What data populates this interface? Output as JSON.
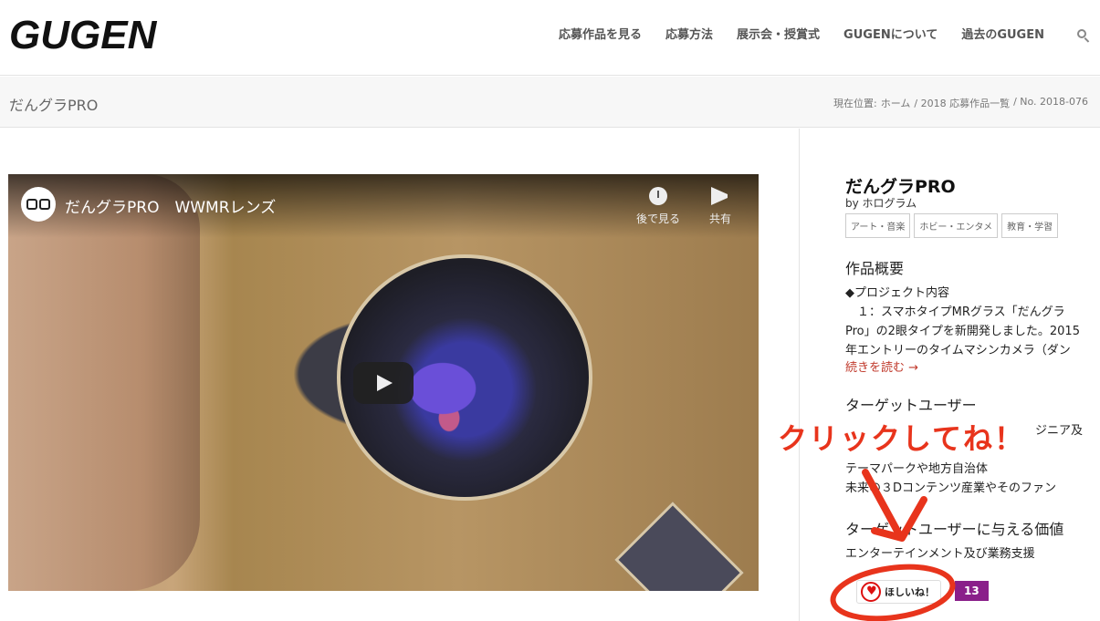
{
  "header": {
    "logo": "GUGEN",
    "nav": [
      "応募作品を見る",
      "応募方法",
      "展示会・授賞式",
      "GUGENについて",
      "過去のGUGEN"
    ]
  },
  "titlebar": {
    "title": "だんグラPRO",
    "breadcrumb_label": "現在位置:",
    "crumbs": [
      "ホーム",
      "/ 2018 応募作品一覧",
      "/ No. 2018-076"
    ]
  },
  "video": {
    "title": "だんグラPRO　WWMRレンズ",
    "watch_later": "後で見る",
    "share": "共有"
  },
  "sidebar": {
    "title": "だんグラPRO",
    "by": "by ホログラム",
    "tags": [
      "アート・音楽",
      "ホビー・エンタメ",
      "教育・学習"
    ],
    "summary_heading": "作品概要",
    "summary_lines": [
      "◆プロジェクト内容",
      "　１：スマホタイプMRグラス「だんグラ",
      "Pro」の2眼タイプを新開発しました。2015",
      "年エントリーのタイムマシンカメラ（ダン"
    ],
    "read_more": "続きを読む →",
    "target_heading": "ターゲットユーザー",
    "target_lines": [
      "ジニア及",
      "テーマパークや地方自治体",
      "未来の３Dコンテンツ産業やそのファン"
    ],
    "value_heading": "ターゲットユーザーに与える価値",
    "value_text": "エンターテインメント及び業務支援",
    "want_label": "ほしいね！",
    "want_count": "13"
  },
  "annotation": {
    "text": "クリックしてね！",
    "color": "#e8341c"
  }
}
